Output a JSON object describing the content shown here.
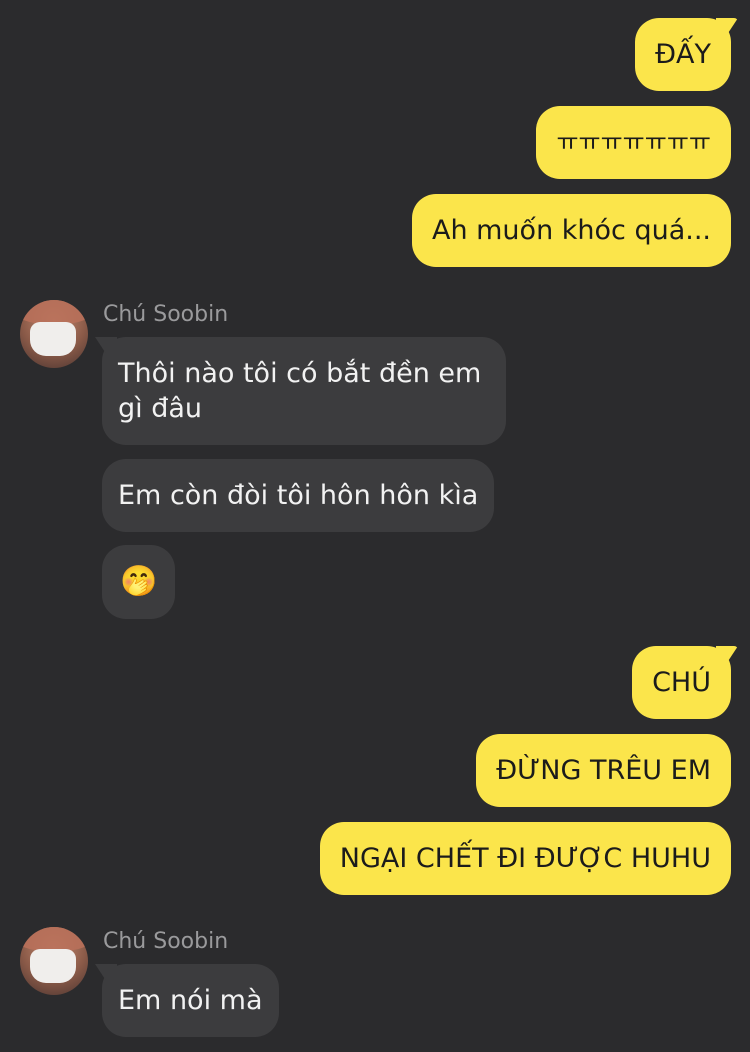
{
  "conversation": {
    "messages": [
      {
        "from": "me",
        "text": "ĐẤY"
      },
      {
        "from": "me",
        "text": "ㅠㅠㅠㅠㅠㅠㅠ"
      },
      {
        "from": "me",
        "text": "Ah muốn khóc quá..."
      },
      {
        "from": "other",
        "sender": "Chú Soobin",
        "text": "Thôi nào tôi có bắt đền em gì đâu"
      },
      {
        "from": "other",
        "text": "Em còn đòi tôi hôn hôn kìa"
      },
      {
        "from": "other",
        "text": "🤭"
      },
      {
        "from": "me",
        "text": "CHÚ"
      },
      {
        "from": "me",
        "text": "ĐỪNG TRÊU EM"
      },
      {
        "from": "me",
        "text": "NGẠI CHẾT ĐI ĐƯỢC HUHU"
      },
      {
        "from": "other",
        "sender": "Chú Soobin",
        "text": "Em nói mà"
      }
    ]
  },
  "colors": {
    "background": "#2b2b2d",
    "outgoing_bubble": "#fbe54b",
    "incoming_bubble": "#3c3c3e",
    "sender_name": "#9a9a9c"
  }
}
